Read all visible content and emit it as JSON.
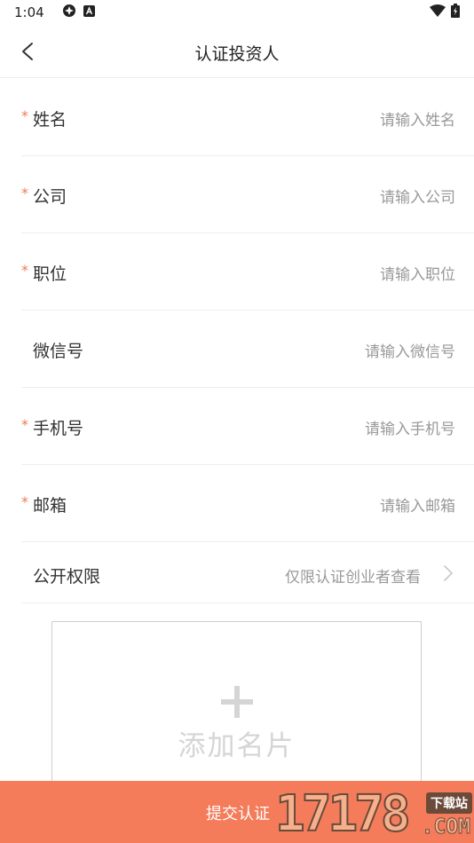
{
  "status_bar": {
    "time": "1:04",
    "left_icons": [
      "settings-icon",
      "a-notification-icon"
    ],
    "right_icons": [
      "wifi-icon",
      "battery-icon"
    ]
  },
  "header": {
    "title": "认证投资人"
  },
  "form": {
    "required_mark": "*",
    "fields": [
      {
        "label": "姓名",
        "placeholder": "请输入姓名",
        "required": true
      },
      {
        "label": "公司",
        "placeholder": "请输入公司",
        "required": true
      },
      {
        "label": "职位",
        "placeholder": "请输入职位",
        "required": true
      },
      {
        "label": "微信号",
        "placeholder": "请输入微信号",
        "required": false
      },
      {
        "label": "手机号",
        "placeholder": "请输入手机号",
        "required": true
      },
      {
        "label": "邮箱",
        "placeholder": "请输入邮箱",
        "required": true
      }
    ],
    "permission": {
      "label": "公开权限",
      "value": "仅限认证创业者查看"
    }
  },
  "card_upload": {
    "label": "添加名片"
  },
  "submit": {
    "label": "提交认证"
  },
  "watermark": {
    "digits": "17178",
    "badge": "下载站",
    "domain": ".COM"
  },
  "colors": {
    "accent": "#f47c5b",
    "required": "#f07a55",
    "placeholder": "#999999",
    "divider": "#eeeeee"
  }
}
